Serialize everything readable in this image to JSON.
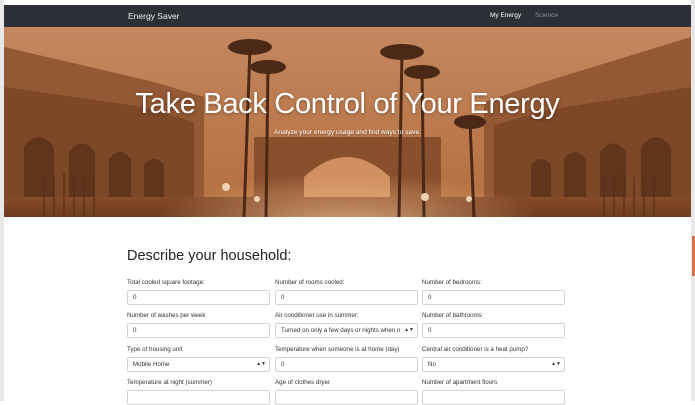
{
  "navbar": {
    "brand": "Energy Saver",
    "links": [
      "My Energy",
      "Science"
    ]
  },
  "hero": {
    "title": "Take Back Control of Your Energy",
    "subtitle": "Analyze your energy usage and find ways to save."
  },
  "form": {
    "heading": "Describe your household:",
    "fields": [
      {
        "label": "Total cooled square footage:",
        "value": "0",
        "type": "text"
      },
      {
        "label": "Number of rooms cooled:",
        "value": "0",
        "type": "text"
      },
      {
        "label": "Number of bedrooms:",
        "value": "0",
        "type": "text"
      },
      {
        "label": "Number of washes per week",
        "value": "0",
        "type": "text"
      },
      {
        "label": "Air conditioner use in summer:",
        "value": "Turned on only a few days or nights when n",
        "type": "select"
      },
      {
        "label": "Number of bathrooms",
        "value": "0",
        "type": "text"
      },
      {
        "label": "Type of housing unit",
        "value": "Mobile Home",
        "type": "select"
      },
      {
        "label": "Temperature when someone is at home (day)",
        "value": "0",
        "type": "text"
      },
      {
        "label": "Central air conditioner is a heat pump?",
        "value": "No",
        "type": "select"
      },
      {
        "label": "Temperature at night (summer)",
        "value": "",
        "type": "text"
      },
      {
        "label": "Age of clothes dryer",
        "value": "",
        "type": "text"
      },
      {
        "label": "Number of apartment floors",
        "value": "",
        "type": "text"
      }
    ]
  },
  "colors": {
    "navbar_bg": "#2c3036",
    "hero_tint": "#c9865a",
    "accent": "#d8744a"
  }
}
